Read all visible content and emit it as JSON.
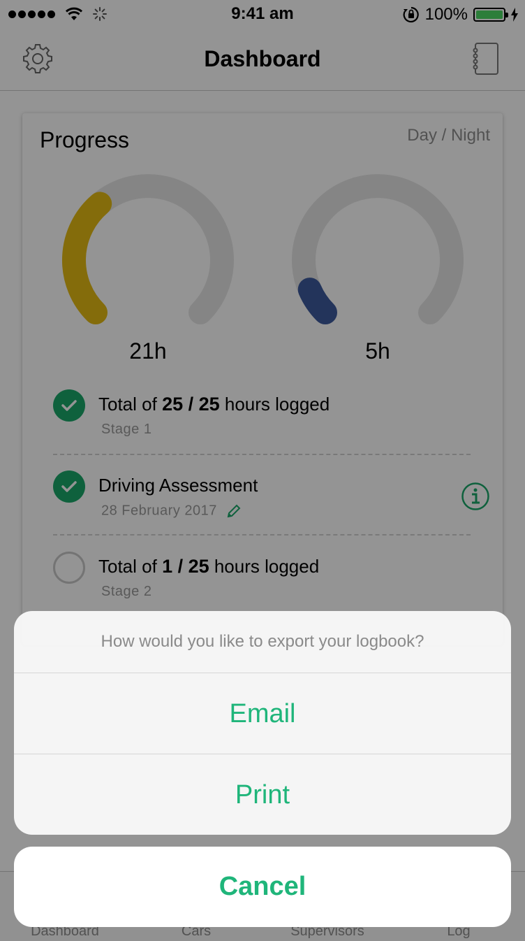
{
  "status_bar": {
    "time": "9:41 am",
    "battery_percent": "100%",
    "battery_level": 1.0
  },
  "nav": {
    "title": "Dashboard",
    "left_icon": "gear-icon",
    "right_icon": "notebook-icon"
  },
  "progress": {
    "title": "Progress",
    "toggle_label": "Day / Night",
    "day_gauge": {
      "value_label": "21h",
      "fraction": 0.35,
      "color": "#e4bb14"
    },
    "night_gauge": {
      "value_label": "5h",
      "fraction": 0.08,
      "color": "#3d5a9e"
    },
    "items": [
      {
        "prefix": "Total of ",
        "bold": "25 / 25",
        "suffix": " hours logged",
        "sub": "Stage 1",
        "done": true
      },
      {
        "label": "Driving Assessment",
        "sub": "28 February 2017",
        "done": true
      },
      {
        "prefix": "Total of ",
        "bold": "1 / 25",
        "suffix": " hours logged",
        "sub": "Stage 2",
        "done": false
      }
    ]
  },
  "tabs": [
    "Dashboard",
    "Cars",
    "Supervisors",
    "Log"
  ],
  "action_sheet": {
    "message": "How would you like to export your logbook?",
    "options": [
      "Email",
      "Print"
    ],
    "cancel": "Cancel",
    "accent_color": "#1fb57a"
  }
}
